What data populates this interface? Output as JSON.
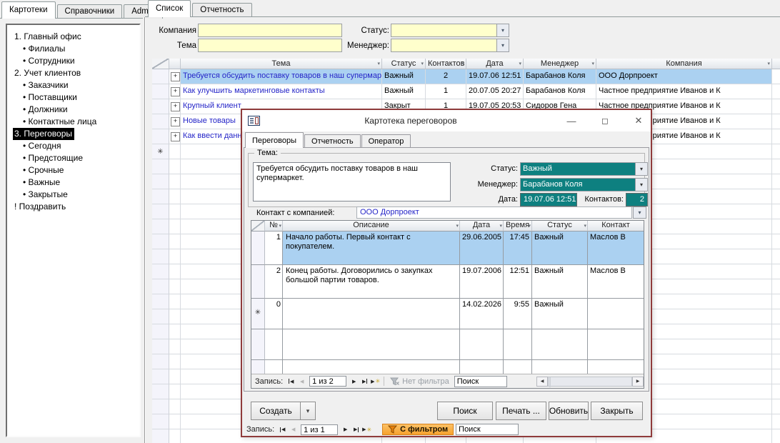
{
  "colors": {
    "accent_teal": "#0E8080",
    "selection_blue": "#ABD1F1",
    "input_yellow": "#FFFFCC",
    "link_blue": "#2525C8",
    "dialog_border": "#8F3B3B",
    "filter_orange": "#F6A22D",
    "filter_orange_light": "#FBC167",
    "highlight_black": "#000000"
  },
  "icons": {
    "minimize": "—",
    "maximize": "◻",
    "close": "✕",
    "dropdown": "▾",
    "sort": "▾",
    "nav_first": "◀",
    "nav_prev": "◀",
    "nav_next": "▶",
    "nav_last": "▶",
    "nav_new": "▶",
    "new_star": "✳",
    "scroll_left": "◀",
    "scroll_right": "▶"
  },
  "window_tabs": [
    {
      "label": "Картотеки",
      "active": true
    },
    {
      "label": "Справочники",
      "active": false
    },
    {
      "label": "Admin",
      "active": false
    }
  ],
  "pane_tabs": [
    {
      "label": "Список",
      "active": true
    },
    {
      "label": "Отчетность",
      "active": false
    }
  ],
  "sidebar": {
    "items": [
      {
        "label": "1. Главный офис",
        "indent": false,
        "selected": false
      },
      {
        "label": "• Филиалы",
        "indent": true,
        "selected": false
      },
      {
        "label": "• Сотрудники",
        "indent": true,
        "selected": false
      },
      {
        "label": "2. Учет клиентов",
        "indent": false,
        "selected": false
      },
      {
        "label": "• Заказчики",
        "indent": true,
        "selected": false
      },
      {
        "label": "• Поставщики",
        "indent": true,
        "selected": false
      },
      {
        "label": "• Должники",
        "indent": true,
        "selected": false
      },
      {
        "label": "• Контактные лица",
        "indent": true,
        "selected": false
      },
      {
        "label": "3. Переговоры",
        "indent": false,
        "selected": true
      },
      {
        "label": "• Сегодня",
        "indent": true,
        "selected": false
      },
      {
        "label": "• Предстоящие",
        "indent": true,
        "selected": false
      },
      {
        "label": "• Срочные",
        "indent": true,
        "selected": false
      },
      {
        "label": "• Важные",
        "indent": true,
        "selected": false
      },
      {
        "label": "• Закрытые",
        "indent": true,
        "selected": false
      },
      {
        "label": "! Поздравить",
        "indent": false,
        "selected": false
      }
    ]
  },
  "filters": {
    "company_label": "Компания",
    "company_value": "",
    "tema_label": "Тема",
    "tema_value": "",
    "status_label": "Статус:",
    "status_value": "",
    "manager_label": "Менеджер:",
    "manager_value": ""
  },
  "main_table": {
    "headers": {
      "tema": "Тема",
      "status": "Статус",
      "contacts": "Контактов",
      "date": "Дата",
      "manager": "Менеджер",
      "company": "Компания"
    },
    "rows": [
      {
        "tema": "Требуется обсудить поставку товаров в наш супермаркет.",
        "status": "Важный",
        "contacts": "2",
        "date": "19.07.06 12:51",
        "manager": "Барабанов Коля",
        "company": "ООО Дорпроект",
        "selected": true,
        "star": false
      },
      {
        "tema": "Как улучшить маркетинговые контакты",
        "status": "Важный",
        "contacts": "1",
        "date": "20.07.05 20:27",
        "manager": "Барабанов Коля",
        "company": "Частное предприятие Иванов и К",
        "selected": false,
        "star": false
      },
      {
        "tema": "Крупный клиент",
        "status": "Закрыт",
        "contacts": "1",
        "date": "19.07.05 20:53",
        "manager": "Сидоров Гена",
        "company": "Частное предприятие Иванов и К",
        "selected": false,
        "star": false
      },
      {
        "tema": "Новые товары",
        "status": "",
        "contacts": "",
        "date": "",
        "manager": "",
        "company": "Частное предприятие Иванов и К",
        "selected": false,
        "star": false
      },
      {
        "tema": "Как ввести данные",
        "status": "",
        "contacts": "",
        "date": "",
        "manager": "",
        "company": "Частное предприятие Иванов и К",
        "selected": false,
        "star": false
      },
      {
        "tema": "",
        "status": "",
        "contacts": "",
        "date": "",
        "manager": "",
        "company": "",
        "selected": false,
        "star": true
      }
    ]
  },
  "dialog": {
    "title": "Картотека переговоров",
    "tabs": [
      {
        "label": "Переговоры",
        "active": true
      },
      {
        "label": "Отчетность",
        "active": false
      },
      {
        "label": "Оператор",
        "active": false
      }
    ],
    "tema_group_label": "Тема:",
    "tema_text": "Требуется обсудить поставку товаров в наш супермаркет.",
    "status_label": "Статус:",
    "status_value": "Важный",
    "manager_label": "Менеджер:",
    "manager_value": "Барабанов Коля",
    "date_label": "Дата:",
    "date_value": "19.07.06 12:51",
    "contacts_label": "Контактов:",
    "contacts_value": "2",
    "company_label": "Контакт с компанией:",
    "company_value": "ООО Дорпроект",
    "table": {
      "headers": {
        "n": "№",
        "desc": "Описание",
        "date": "Дата",
        "time": "Время",
        "status": "Статус",
        "contact": "Контакт"
      },
      "rows": [
        {
          "n": "1",
          "desc": "Начало работы. Первый контакт с покупателем.",
          "date": "29.06.2005",
          "time": "17:45",
          "status": "Важный",
          "contact": "Маслов В",
          "selected": true,
          "star": false
        },
        {
          "n": "2",
          "desc": "Конец работы. Договорились о закупках большой партии товаров.",
          "date": "19.07.2006",
          "time": "12:51",
          "status": "Важный",
          "contact": "Маслов В",
          "selected": false,
          "star": false
        },
        {
          "n": "0",
          "desc": "",
          "date": "14.02.2026",
          "time": "9:55",
          "status": "Важный",
          "contact": "",
          "selected": false,
          "star": true
        }
      ]
    },
    "inner_nav": {
      "record_label": "Запись:",
      "position": "1 из 2",
      "no_filter": "Нет фильтра",
      "search_value": "Поиск"
    },
    "buttons": {
      "create": "Создать",
      "search": "Поиск",
      "print": "Печать ...",
      "refresh": "Обновить",
      "close": "Закрыть"
    },
    "bottom_nav": {
      "record_label": "Запись:",
      "position": "1 из 1",
      "filtered": "С фильтром",
      "search_value": "Поиск"
    }
  }
}
